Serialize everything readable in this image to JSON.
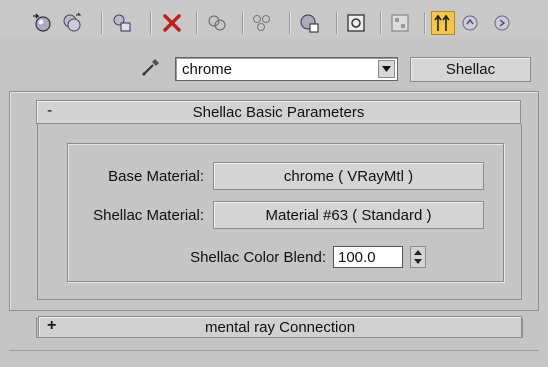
{
  "toolbar": {
    "buttons": [
      {
        "icon": "get-material-icon"
      },
      {
        "icon": "put-to-scene-icon"
      },
      {
        "icon": "assign-to-selection-icon"
      },
      {
        "icon": "reset-map-icon"
      },
      {
        "icon": "make-copy-icon"
      },
      {
        "icon": "make-unique-icon"
      },
      {
        "icon": "put-to-library-icon"
      },
      {
        "icon": "material-id-channel-icon"
      },
      {
        "icon": "show-map-in-viewport-icon"
      },
      {
        "icon": "show-end-result-icon"
      },
      {
        "icon": "go-to-parent-icon"
      },
      {
        "icon": "go-forward-to-sibling-icon"
      }
    ],
    "active_button": "show-end-result-icon",
    "accent_color": "#f2c64a"
  },
  "material": {
    "name": "chrome",
    "type_button": "Shellac"
  },
  "rollout_basic": {
    "toggle": "-",
    "title": "Shellac Basic Parameters",
    "base_label": "Base Material:",
    "base_value": "chrome  ( VRayMtl )",
    "shellac_label": "Shellac Material:",
    "shellac_value": "Material #63  ( Standard )",
    "blend_label": "Shellac Color Blend:",
    "blend_value": "100.0"
  },
  "rollout_mental": {
    "toggle": "+",
    "title": "mental ray Connection"
  }
}
